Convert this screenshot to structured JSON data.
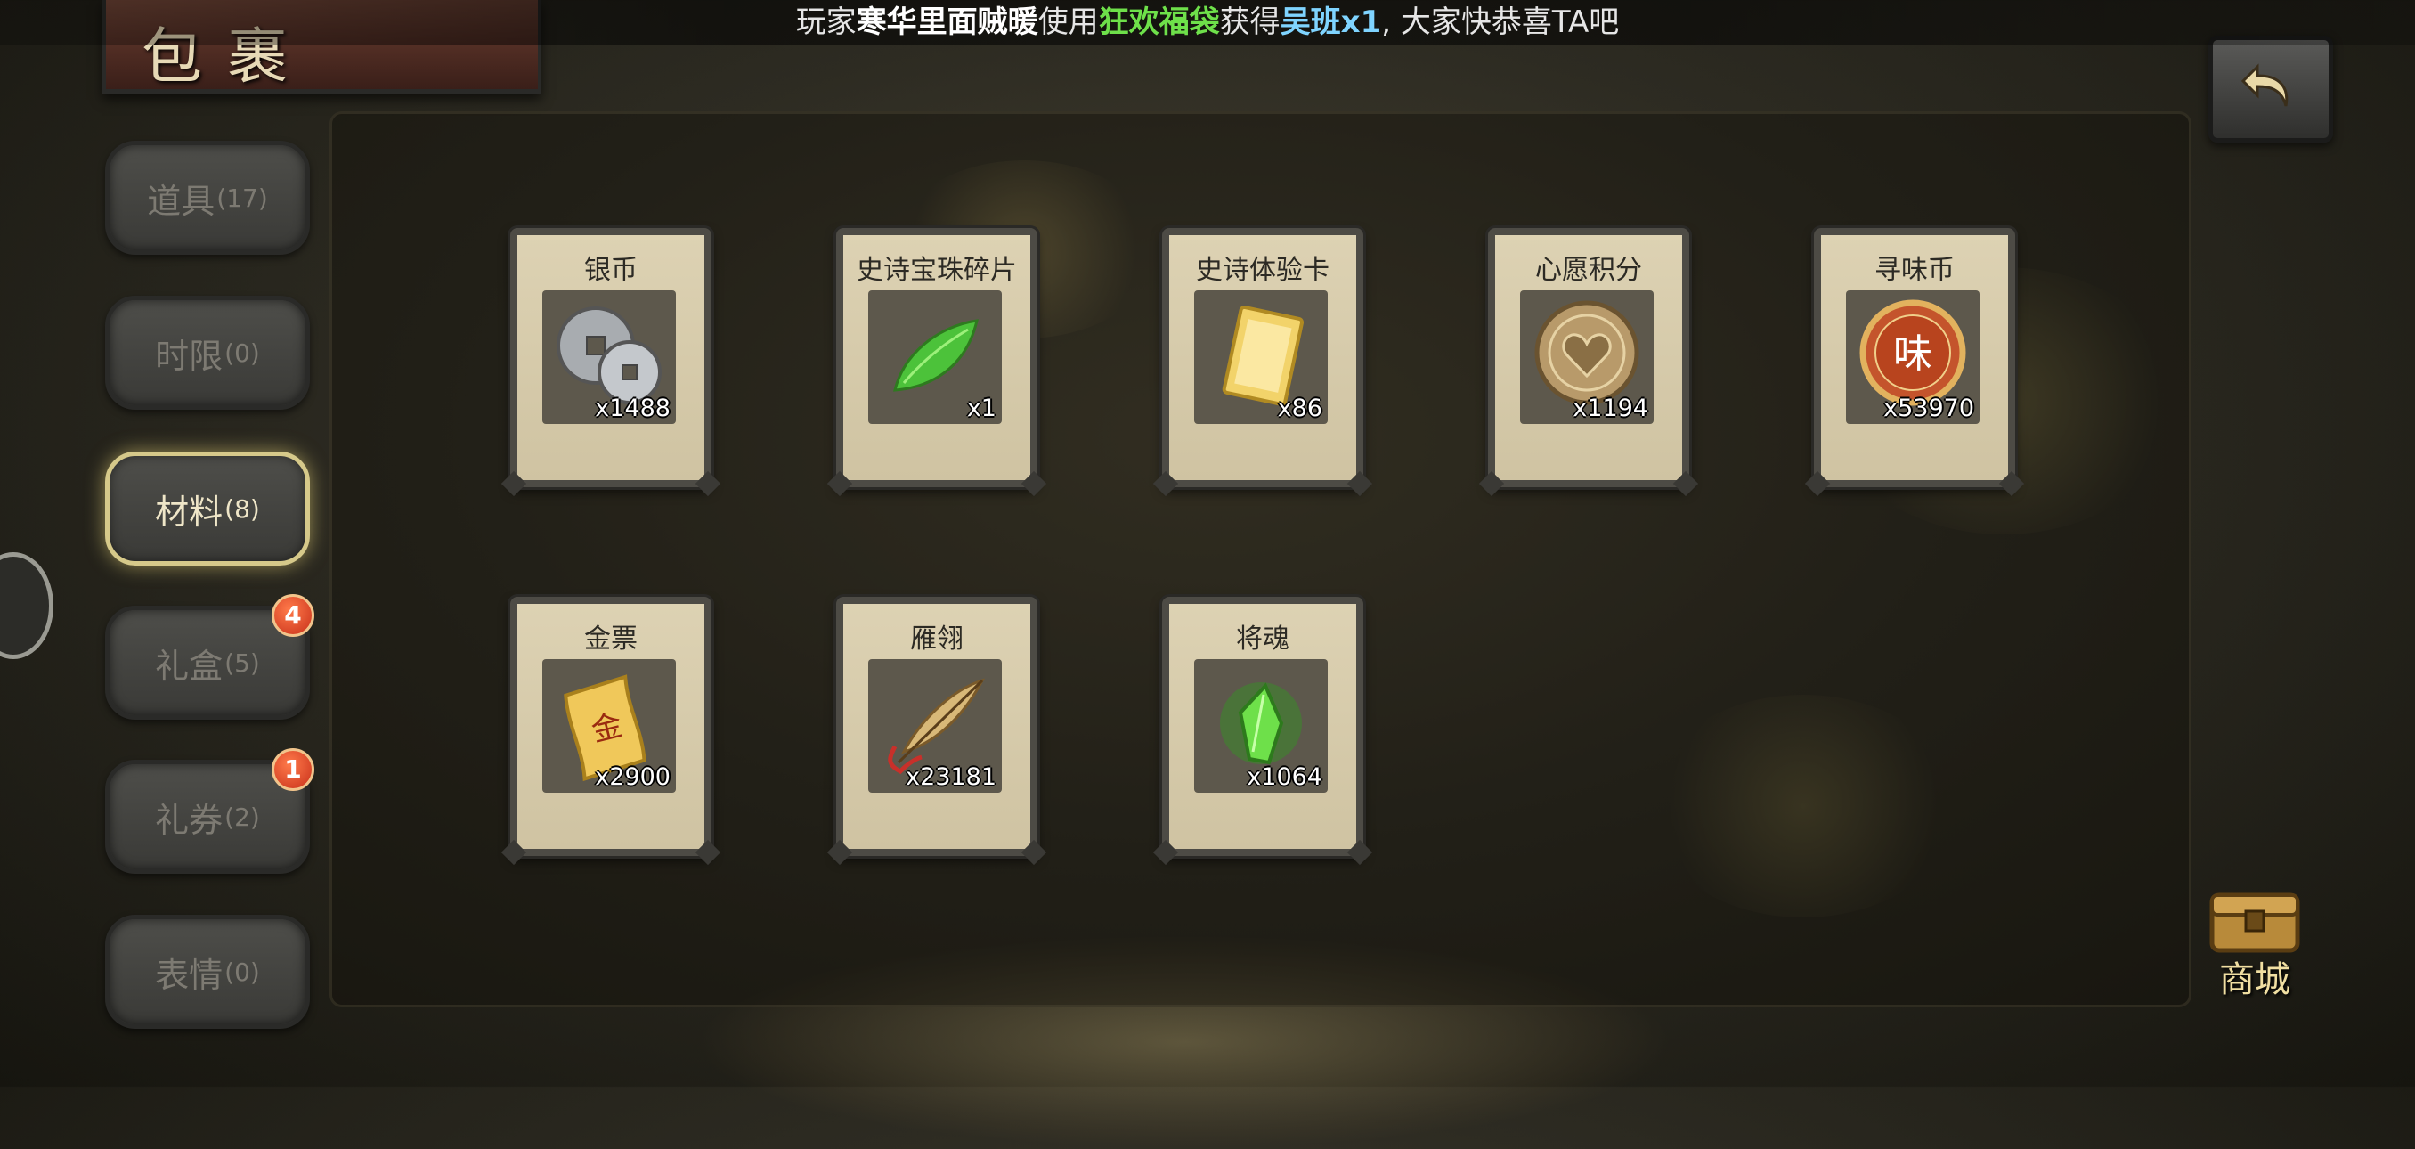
{
  "marquee": {
    "prefix": "玩家",
    "player": "寒华里面贼暖",
    "use_text": "使用",
    "item_used": "狂欢福袋",
    "get_text": "获得",
    "reward": "吴班x1",
    "suffix": ", 大家快恭喜TA吧"
  },
  "header": {
    "title": "包裹"
  },
  "tabs": [
    {
      "label": "道具",
      "count": "(17)",
      "badge": ""
    },
    {
      "label": "时限",
      "count": "(0)",
      "badge": ""
    },
    {
      "label": "材料",
      "count": "(8)",
      "badge": ""
    },
    {
      "label": "礼盒",
      "count": "(5)",
      "badge": "4"
    },
    {
      "label": "礼券",
      "count": "(2)",
      "badge": "1"
    },
    {
      "label": "表情",
      "count": "(0)",
      "badge": ""
    }
  ],
  "items": [
    {
      "name": "银币",
      "qty": "x1488",
      "icon": "silver-coins-icon"
    },
    {
      "name": "史诗宝珠碎片",
      "qty": "x1",
      "icon": "green-shard-icon"
    },
    {
      "name": "史诗体验卡",
      "qty": "x86",
      "icon": "gold-card-icon"
    },
    {
      "name": "心愿积分",
      "qty": "x1194",
      "icon": "heart-coin-icon"
    },
    {
      "name": "寻味币",
      "qty": "x53970",
      "icon": "flavor-coin-icon"
    },
    {
      "name": "金票",
      "qty": "x2900",
      "icon": "gold-ticket-icon"
    },
    {
      "name": "雁翎",
      "qty": "x23181",
      "icon": "feather-icon"
    },
    {
      "name": "将魂",
      "qty": "x1064",
      "icon": "general-soul-icon"
    }
  ],
  "flavor_coin_glyph": "味",
  "gold_ticket_glyph": "金",
  "shop": {
    "label": "商城"
  },
  "colors": {
    "player": "#ffffff",
    "item_used": "#6ee04a",
    "reward": "#7fd4ff",
    "active_tab_border": "#d6c98a",
    "badge": "#d8452a"
  }
}
